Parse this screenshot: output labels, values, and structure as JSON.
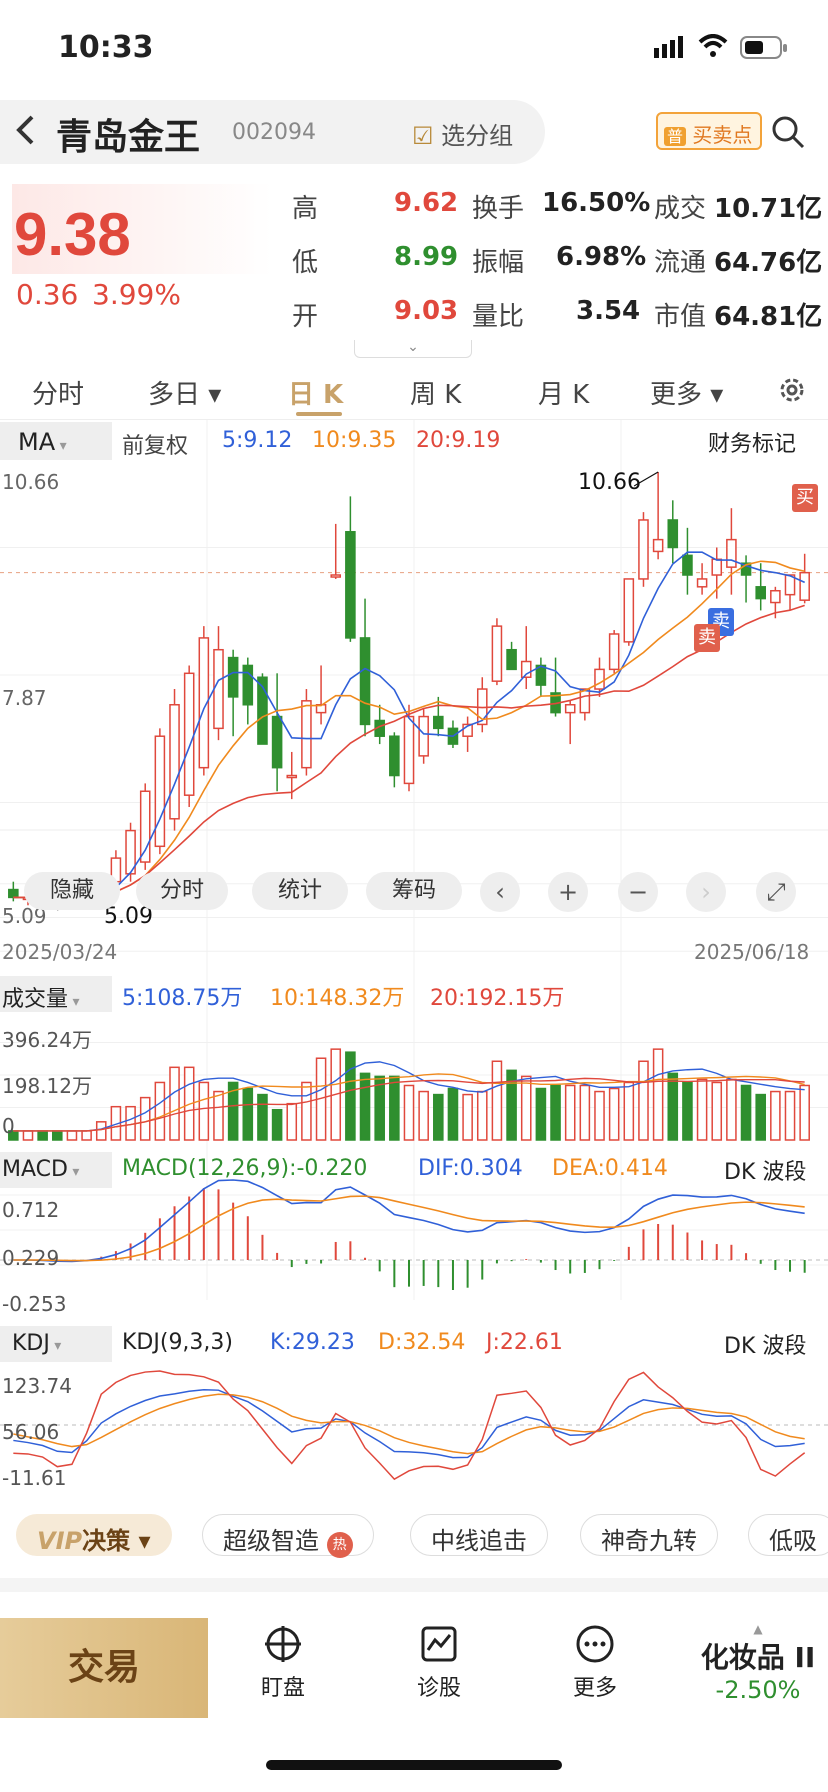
{
  "status_bar": {
    "time": "10:33"
  },
  "header": {
    "stock_name": "青岛金王",
    "stock_code": "002094",
    "group_label": "选分组",
    "buy_sell_badge": "普",
    "buy_sell_label": "买卖点"
  },
  "quote": {
    "price": "9.38",
    "change": "0.36",
    "change_pct": "3.99%",
    "rows": [
      {
        "l1": "高",
        "v1": "9.62",
        "l2": "换手",
        "v2": "16.50%",
        "l3": "成交",
        "v3": "10.71亿"
      },
      {
        "l1": "低",
        "v1": "8.99",
        "l2": "振幅",
        "v2": "6.98%",
        "l3": "流通",
        "v3": "64.76亿"
      },
      {
        "l1": "开",
        "v1": "9.03",
        "l2": "量比",
        "v2": "3.54",
        "l3": "市值",
        "v3": "64.81亿"
      }
    ]
  },
  "tabs": [
    {
      "label": "分时"
    },
    {
      "label": "多日 ▾"
    },
    {
      "label": "日 K"
    },
    {
      "label": "周 K"
    },
    {
      "label": "月 K"
    },
    {
      "label": "更多 ▾"
    }
  ],
  "ma_bar": {
    "label": "MA",
    "adjust": "前复权",
    "ma5": "5:9.12",
    "ma10": "10:9.35",
    "ma20": "20:9.19",
    "finance_mark": "财务标记"
  },
  "kline": {
    "y_top": "10.66",
    "y_mid": "7.87",
    "y_bot": "5.09",
    "high_label": "10.66",
    "low_label": "5.09",
    "date_start": "2025/03/24",
    "date_end": "2025/06/18",
    "buy_tag": "买",
    "sell_tag": "卖",
    "sell_tag2": "卖"
  },
  "overlay": {
    "hide": "隐藏",
    "timeshare": "分时",
    "stats": "统计",
    "chips": "筹码",
    "prev": "‹",
    "zoom_in": "+",
    "zoom_out": "−",
    "next": "›",
    "fullscreen": "⤢"
  },
  "volume": {
    "label": "成交量",
    "ma5": "5:108.75万",
    "ma10": "10:148.32万",
    "ma20": "20:192.15万",
    "y_top": "396.24万",
    "y_mid": "198.12万",
    "y_bot": "0"
  },
  "macd": {
    "label": "MACD",
    "params": "MACD(12,26,9):-0.220",
    "dif": "DIF:0.304",
    "dea": "DEA:0.414",
    "dk": "DK 波段",
    "y_top": "0.712",
    "y_mid": "0.229",
    "y_bot": "-0.253"
  },
  "kdj": {
    "label": "KDJ",
    "params": "KDJ(9,3,3)",
    "k": "K:29.23",
    "d": "D:32.54",
    "j": "J:22.61",
    "dk": "DK 波段",
    "y_top": "123.74",
    "y_mid": "56.06",
    "y_bot": "-11.61"
  },
  "features": {
    "vip_prefix": "VIP",
    "vip_label": "决策 ▾",
    "items": [
      "超级智造",
      "中线追击",
      "神奇九转",
      "低吸"
    ],
    "hot": "热"
  },
  "bottom_nav": {
    "trade": "交易",
    "watch": "盯盘",
    "diagnose": "诊股",
    "more": "更多",
    "sector_name": "化妆品 II",
    "sector_change": "-2.50%"
  },
  "colors": {
    "up": "#e0483c",
    "down": "#2f8f2f",
    "ma5": "#3060d8",
    "ma10": "#f08a1e",
    "ma20": "#e0483c",
    "gold": "#c8a26a"
  },
  "chart_data": {
    "type": "candlestick",
    "ylim": [
      5.09,
      10.66
    ],
    "open": [
      5.35,
      5.25,
      5.28,
      5.18,
      5.14,
      5.2,
      5.3,
      5.45,
      5.55,
      5.7,
      5.9,
      6.25,
      6.55,
      6.9,
      7.4,
      8.3,
      8.2,
      8.05,
      7.55,
      6.8,
      6.9,
      7.6,
      9.35,
      9.9,
      8.55,
      7.5,
      7.3,
      6.7,
      7.05,
      7.55,
      7.4,
      7.3,
      7.45,
      8.0,
      8.4,
      8.05,
      8.2,
      7.85,
      7.6,
      7.6,
      7.9,
      8.15,
      8.5,
      9.3,
      9.65,
      10.05,
      9.6,
      9.2,
      9.35,
      9.45,
      9.5,
      9.2,
      9.0,
      9.1,
      9.03
    ],
    "high": [
      5.45,
      5.4,
      5.35,
      5.25,
      5.2,
      5.35,
      5.5,
      5.85,
      6.2,
      6.7,
      7.4,
      7.9,
      8.2,
      8.7,
      8.7,
      8.4,
      8.3,
      8.1,
      8.1,
      7.1,
      7.9,
      8.2,
      10.0,
      10.35,
      9.05,
      7.7,
      7.35,
      7.7,
      7.65,
      7.8,
      7.5,
      7.55,
      8.05,
      8.8,
      8.5,
      8.7,
      8.3,
      8.3,
      7.75,
      7.9,
      8.3,
      8.65,
      9.3,
      10.15,
      10.66,
      10.3,
      9.95,
      9.5,
      9.7,
      10.2,
      9.6,
      9.5,
      9.2,
      9.3,
      9.62
    ],
    "low": [
      5.2,
      5.15,
      5.1,
      5.09,
      5.09,
      5.15,
      5.2,
      5.35,
      5.45,
      5.6,
      5.8,
      6.1,
      6.4,
      6.8,
      7.25,
      7.3,
      7.45,
      7.3,
      6.6,
      6.5,
      6.8,
      7.45,
      9.3,
      8.5,
      7.3,
      7.2,
      6.65,
      6.6,
      6.95,
      7.3,
      7.15,
      7.1,
      7.35,
      7.95,
      8.2,
      7.9,
      7.8,
      7.55,
      7.2,
      7.5,
      7.8,
      8.1,
      8.45,
      9.2,
      9.55,
      9.5,
      9.1,
      9.1,
      9.05,
      9.1,
      9.0,
      8.9,
      8.8,
      8.9,
      8.99
    ],
    "close": [
      5.25,
      5.25,
      5.2,
      5.15,
      5.18,
      5.32,
      5.48,
      5.75,
      6.1,
      6.6,
      7.3,
      7.7,
      8.1,
      8.55,
      8.4,
      7.8,
      7.7,
      7.2,
      6.9,
      6.8,
      7.75,
      7.7,
      9.35,
      8.55,
      7.45,
      7.3,
      6.8,
      7.55,
      7.55,
      7.4,
      7.2,
      7.45,
      7.9,
      8.7,
      8.15,
      8.25,
      7.95,
      7.6,
      7.7,
      7.9,
      8.15,
      8.6,
      9.3,
      10.05,
      9.8,
      9.7,
      9.35,
      9.3,
      9.55,
      9.8,
      9.35,
      9.05,
      9.15,
      9.35,
      9.38
    ],
    "volume": [
      30,
      30,
      30,
      30,
      30,
      30,
      60,
      110,
      110,
      140,
      190,
      240,
      240,
      190,
      160,
      190,
      170,
      150,
      100,
      120,
      190,
      270,
      300,
      290,
      220,
      210,
      210,
      180,
      160,
      150,
      170,
      150,
      160,
      260,
      230,
      210,
      170,
      180,
      180,
      180,
      160,
      170,
      190,
      260,
      300,
      220,
      190,
      200,
      190,
      200,
      180,
      150,
      160,
      160,
      180
    ],
    "ma5_last": 9.12,
    "ma10_last": 9.35,
    "ma20_last": 9.19,
    "date_start": "2025/03/24",
    "date_end": "2025/06/18"
  }
}
